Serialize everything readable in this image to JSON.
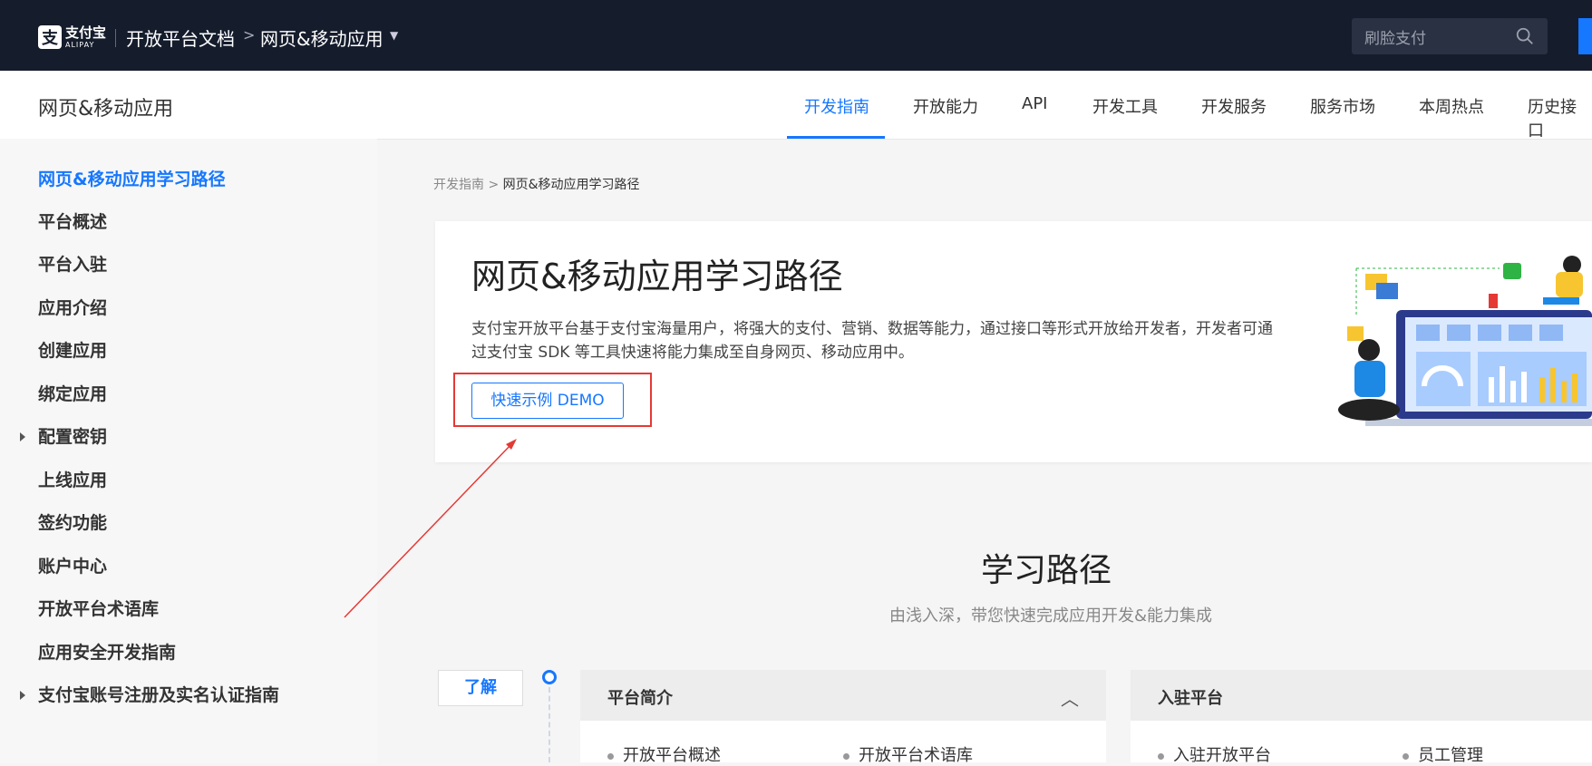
{
  "topbar": {
    "logo_cn": "支付宝",
    "logo_en": "ALIPAY",
    "docs_label": "开放平台文档",
    "separator": ">",
    "app_label": "网页&移动应用",
    "search_placeholder": "刷脸支付"
  },
  "subnav": {
    "title": "网页&移动应用",
    "tabs": [
      {
        "label": "开发指南"
      },
      {
        "label": "开放能力"
      },
      {
        "label": "API"
      },
      {
        "label": "开发工具"
      },
      {
        "label": "开发服务"
      },
      {
        "label": "服务市场"
      },
      {
        "label": "本周热点"
      },
      {
        "label": "历史接口"
      }
    ]
  },
  "sidebar": {
    "items": [
      {
        "label": "网页&移动应用学习路径"
      },
      {
        "label": "平台概述"
      },
      {
        "label": "平台入驻"
      },
      {
        "label": "应用介绍"
      },
      {
        "label": "创建应用"
      },
      {
        "label": "绑定应用"
      },
      {
        "label": "配置密钥"
      },
      {
        "label": "上线应用"
      },
      {
        "label": "签约功能"
      },
      {
        "label": "账户中心"
      },
      {
        "label": "开放平台术语库"
      },
      {
        "label": "应用安全开发指南"
      },
      {
        "label": "支付宝账号注册及实名认证指南"
      }
    ]
  },
  "breadcrumb": {
    "parent": "开发指南",
    "sep": ">",
    "current": "网页&移动应用学习路径"
  },
  "hero": {
    "title": "网页&移动应用学习路径",
    "description": "支付宝开放平台基于支付宝海量用户，将强大的支付、营销、数据等能力，通过接口等形式开放给开发者，开发者可通过支付宝 SDK 等工具快速将能力集成至自身网页、移动应用中。",
    "demo_button": "快速示例 DEMO"
  },
  "learning": {
    "title": "学习路径",
    "subtitle": "由浅入深，带您快速完成应用开发&能力集成",
    "stage_tag": "了解",
    "cards": [
      {
        "title": "平台简介",
        "items": [
          "开放平台概述",
          "开放平台术语库"
        ]
      },
      {
        "title": "入驻平台",
        "items": [
          "入驻开放平台",
          "员工管理"
        ]
      }
    ]
  },
  "colors": {
    "accent": "#1677ff",
    "topbar": "#151c2c",
    "annotation": "#e53935"
  }
}
